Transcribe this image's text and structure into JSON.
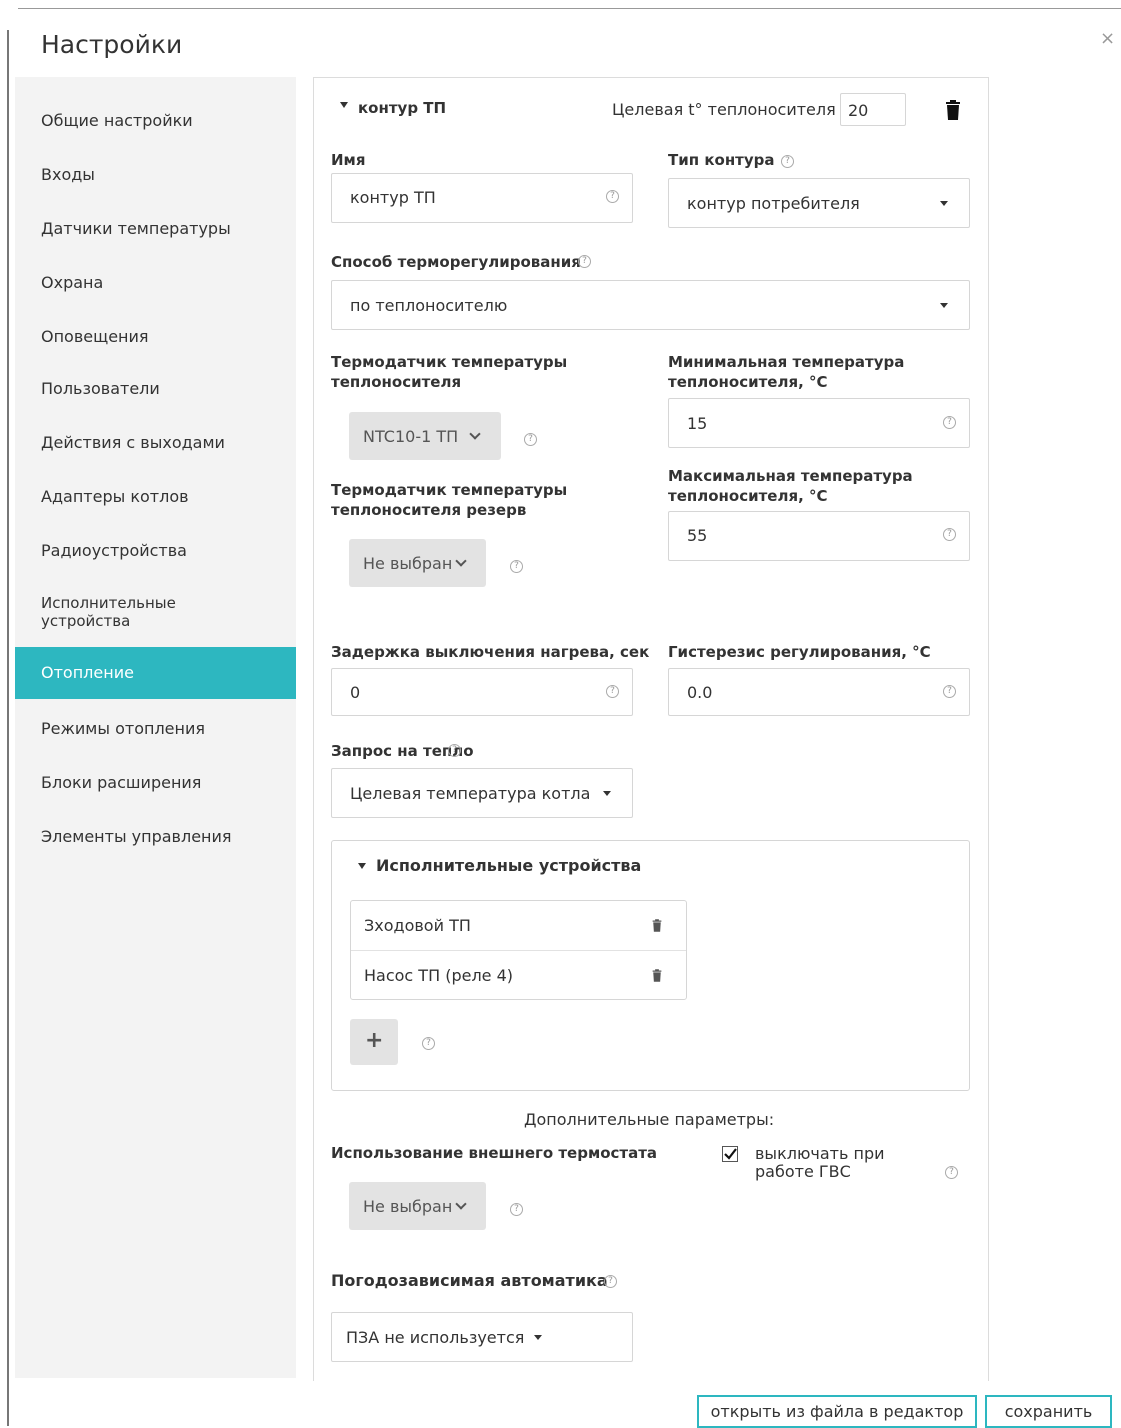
{
  "window": {
    "title": "Настройки",
    "close_glyph": "×"
  },
  "sidebar": {
    "items": [
      {
        "label": "Общие настройки"
      },
      {
        "label": "Входы"
      },
      {
        "label": "Датчики температуры"
      },
      {
        "label": "Охрана"
      },
      {
        "label": "Оповещения"
      },
      {
        "label": "Пользователи"
      },
      {
        "label": "Действия с выходами"
      },
      {
        "label": "Адаптеры котлов"
      },
      {
        "label": "Радиоустройства"
      },
      {
        "label": "Исполнительные устройства"
      },
      {
        "label": "Отопление"
      },
      {
        "label": "Режимы отопления"
      },
      {
        "label": "Блоки расширения"
      },
      {
        "label": "Элементы управления"
      }
    ],
    "active_label": "Отопление",
    "active_color": "#2db7c0"
  },
  "circuit": {
    "name_header": "контур ТП",
    "target_label": "Целевая t° теплоносителя",
    "target_value": "20",
    "name_label": "Имя",
    "name_value": "контур ТП",
    "type_label": "Тип контура",
    "type_value": "контур потребителя",
    "method_label": "Способ терморегулирования",
    "method_value": "по теплоносителю",
    "sensor_label": "Термодатчик температуры теплоносителя",
    "sensor_value": "NTC10-1 ТП",
    "sensor_reserve_label": "Термодатчик температуры теплоносителя резерв",
    "sensor_reserve_value": "Не выбран",
    "min_temp_label": "Минимальная температура теплоносителя, °C",
    "min_temp_value": "15",
    "max_temp_label": "Максимальная температура теплоносителя, °C",
    "max_temp_value": "55",
    "delay_label": "Задержка выключения нагрева, сек",
    "delay_value": "0",
    "hysteresis_label": "Гистерезис регулирования, °C",
    "hysteresis_value": "0.0",
    "heat_request_label": "Запрос на тепло",
    "heat_request_value": "Целевая температура котла",
    "actuators": {
      "header": "Исполнительные устройства",
      "items": [
        {
          "label": "Зходовой ТП"
        },
        {
          "label": "Насос ТП (реле 4)"
        }
      ],
      "add_glyph": "+"
    },
    "additional_label": "Дополнительные параметры:",
    "ext_thermostat_label": "Использование внешнего термостата",
    "ext_thermostat_value": "Не выбран",
    "dhw_checkbox_label": "выключать при работе ГВС",
    "dhw_checked": true,
    "weather_label": "Погодозависимая автоматика",
    "weather_value": "ПЗА не используется"
  },
  "footer": {
    "open_file_label": "открыть из файла в редактор",
    "save_label": "сохранить"
  },
  "help_glyph": "?"
}
